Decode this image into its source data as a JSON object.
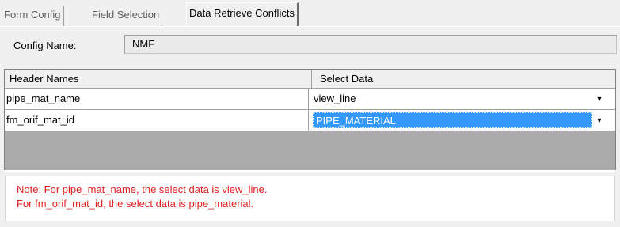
{
  "tabs": [
    {
      "label": "Form Config",
      "active": false
    },
    {
      "label": "Field Selection",
      "active": false
    },
    {
      "label": "Data Retrieve Conflicts",
      "active": true
    }
  ],
  "config": {
    "label": "Config Name:",
    "value": "NMF"
  },
  "grid": {
    "columns": [
      "Header Names",
      "Select Data"
    ],
    "rows": [
      {
        "header": "pipe_mat_name",
        "select": "view_line",
        "selected": false
      },
      {
        "header": "fm_orif_mat_id",
        "select": "PIPE_MATERIAL",
        "selected": true
      }
    ]
  },
  "note": {
    "lines": [
      "Note: For pipe_mat_name, the select data is view_line.",
      "For fm_orif_mat_id, the select data is pipe_material."
    ],
    "color": "#e0201e"
  },
  "icons": {
    "dropdown": "chevron-down-icon"
  },
  "colors": {
    "selection": "#3399ff",
    "background": "#f0f0f0"
  }
}
